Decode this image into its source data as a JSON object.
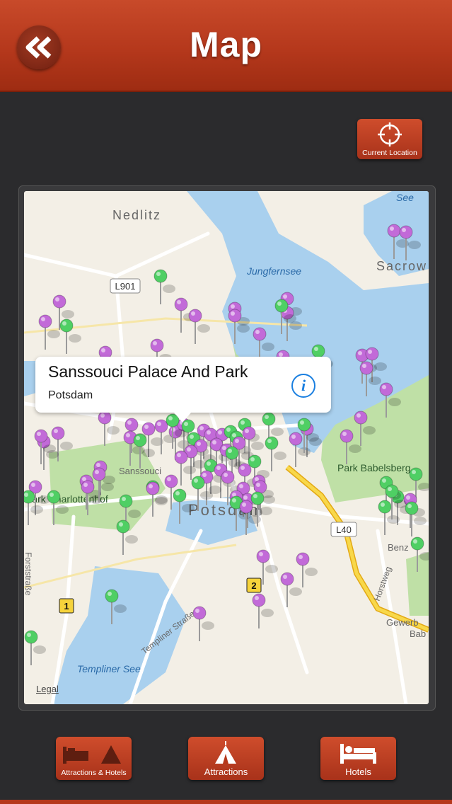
{
  "header": {
    "title": "Map",
    "back_icon": "double-chevron-left-icon"
  },
  "current_location": {
    "label": "Current Location",
    "icon": "crosshair-icon"
  },
  "map": {
    "place_labels": [
      "Nedlitz",
      "Sacrow",
      "Jungfernsee",
      "See",
      "Park Babelsberg",
      "Park Charlottenhof",
      "Sanssouci",
      "Potsdam",
      "Benz",
      "Gewerb",
      "Bab",
      "Templiner See",
      "Templiner Straße",
      "Forststraße",
      "Horstweg"
    ],
    "road_shields": [
      "L901",
      "L40",
      "1",
      "2"
    ],
    "legal": "Legal",
    "callout": {
      "title": "Sanssouci Palace And Park",
      "subtitle": "Potsdam",
      "info_icon": "info-icon"
    },
    "pin_colors": {
      "attraction": "#c26ad8",
      "hotel": "#4fcf64"
    }
  },
  "bottom_nav": [
    {
      "label": "Attractions & Hotels",
      "icon": "bed-and-tent-icon"
    },
    {
      "label": "Attractions",
      "icon": "tent-icon"
    },
    {
      "label": "Hotels",
      "icon": "bed-icon"
    }
  ],
  "colors": {
    "header": "#b5381c",
    "background": "#2b2b2d",
    "water": "#a9d0ee",
    "park": "#bfe0a6",
    "highway": "#f3c623"
  }
}
